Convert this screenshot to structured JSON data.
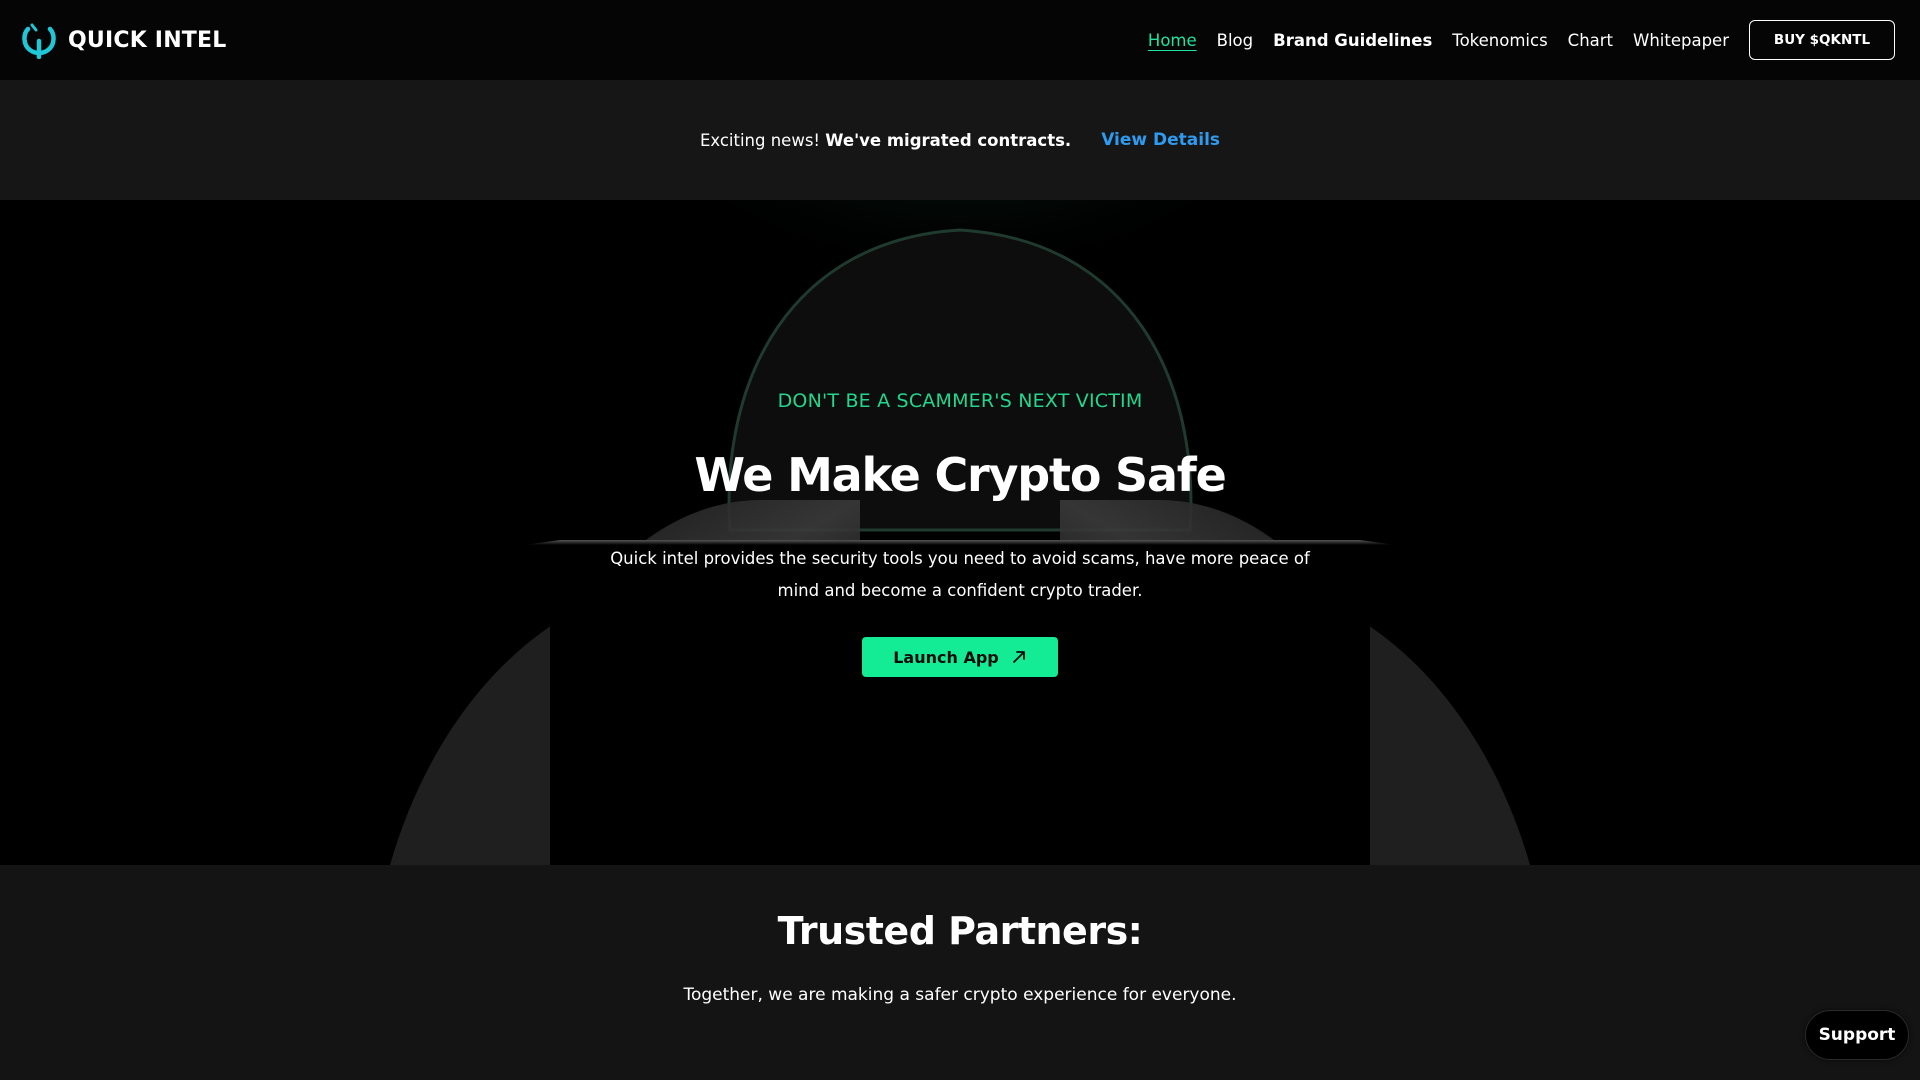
{
  "header": {
    "brand": "QUICK INTEL",
    "nav": [
      {
        "label": "Home",
        "active": true
      },
      {
        "label": "Blog"
      },
      {
        "label": "Brand Guidelines"
      },
      {
        "label": "Tokenomics"
      },
      {
        "label": "Chart"
      },
      {
        "label": "Whitepaper"
      }
    ],
    "buy_label": "BUY $QKNTL"
  },
  "announcement": {
    "lead": "Exciting news!",
    "emphasis": "We've migrated contracts.",
    "link_label": "View Details"
  },
  "hero": {
    "eyebrow": "DON'T BE A SCAMMER'S NEXT VICTIM",
    "title": "We Make Crypto Safe",
    "description": "Quick intel provides the security tools you need to avoid scams, have more peace of mind and become a confident crypto trader.",
    "cta_label": "Launch App",
    "cta_icon": "arrow-up-right-icon"
  },
  "partners": {
    "title": "Trusted Partners:",
    "subtitle": "Together, we are making a safer crypto experience for everyone."
  },
  "support": {
    "label": "Support"
  },
  "colors": {
    "accent_green": "#14eb95",
    "eyebrow_green": "#22d68d",
    "link_blue": "#2e9bf0",
    "logo_cyan": "#1fc8d6"
  }
}
